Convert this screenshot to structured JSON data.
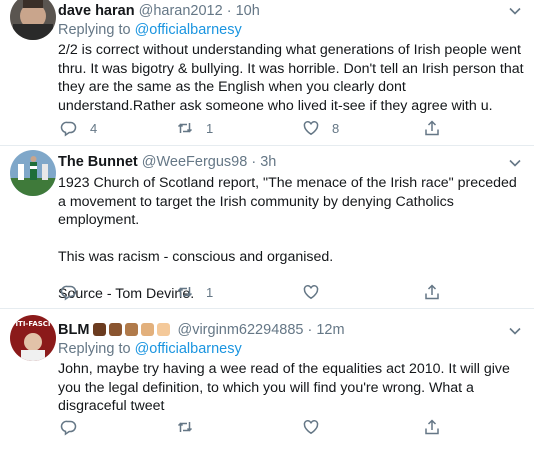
{
  "tweets": [
    {
      "name": "dave haran",
      "handle": "@haran2012",
      "separator": "·",
      "time": "10h",
      "replying_prefix": "Replying to ",
      "replying_to": "@officialbarnesy",
      "body": "2/2 is correct without understanding what generations of Irish people went thru. It was bigotry & bullying. It was horrible. Don't tell an Irish person that they are the same as the English when you clearly dont understand.Rather ask someone who lived it-see if they agree with u.",
      "replies": "4",
      "retweets": "1",
      "likes": "8"
    },
    {
      "name": "The Bunnet",
      "handle": "@WeeFergus98",
      "separator": "·",
      "time": "3h",
      "body_p1": "1923 Church of Scotland report, \"The menace of the Irish race\" preceded a movement to target the Irish community by denying Catholics employment.",
      "body_p2": "This was racism - conscious and organised.",
      "body_p3": "Source - Tom Devine.",
      "replies": "",
      "retweets": "1",
      "likes": ""
    },
    {
      "name": "BLM",
      "avatar_text": "ITI-FASCI",
      "handle": "@virginm62294885",
      "separator": "·",
      "time": "12m",
      "replying_prefix": "Replying to ",
      "replying_to": "@officialbarnesy",
      "body": "John, maybe try having a wee read of the equalities act 2010. It will give you the legal definition, to which you will find you're wrong. What a disgraceful tweet",
      "replies": "",
      "retweets": "",
      "likes": ""
    }
  ],
  "icons": {
    "reply": "reply-icon",
    "retweet": "retweet-icon",
    "like": "heart-icon",
    "share": "share-icon",
    "caret": "chevron-down-icon"
  },
  "colors": {
    "link": "#1b95e0",
    "secondary": "#657786",
    "text": "#14171a",
    "divider": "#e6ecf0",
    "fist_emoji_tones": [
      "#6b3b1f",
      "#8a5530",
      "#b07a4a",
      "#e2b07c",
      "#f4c99a"
    ]
  }
}
